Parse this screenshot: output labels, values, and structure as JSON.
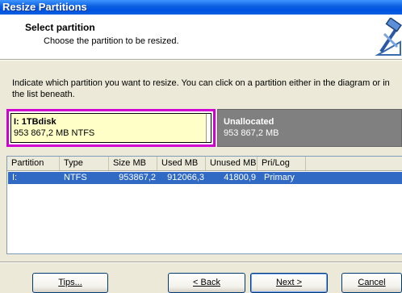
{
  "window": {
    "title": "Resize Partitions"
  },
  "header": {
    "title": "Select partition",
    "subtitle": "Choose the partition to be resized."
  },
  "instructions": "Indicate which partition you want to resize. You can click on a partition either in the diagram or in the list beneath.",
  "diagram": {
    "selected_partition": {
      "name": "I:  1TBdisk",
      "info": "953 867,2 MB    NTFS",
      "color": "#ffffc8",
      "border_color": "#d000d0"
    },
    "unallocated": {
      "name": "Unallocated",
      "info": "953 867,2 MB",
      "color": "#808080"
    }
  },
  "partition_list": {
    "columns": [
      "Partition",
      "Type",
      "Size MB",
      "Used MB",
      "Unused MB",
      "Pri/Log"
    ],
    "rows": [
      {
        "partition": "I:",
        "type": "NTFS",
        "size": "953867,2",
        "used": "912066,3",
        "unused": "41800,9",
        "prilog": "Primary"
      }
    ]
  },
  "buttons": {
    "tips": "Tips...",
    "back": "< Back",
    "next": "Next >",
    "cancel": "Cancel"
  },
  "icons": {
    "header": "wizard-hammer-icon"
  },
  "colors": {
    "titlebar": "#0a5fe0",
    "selection": "#316ac5"
  }
}
